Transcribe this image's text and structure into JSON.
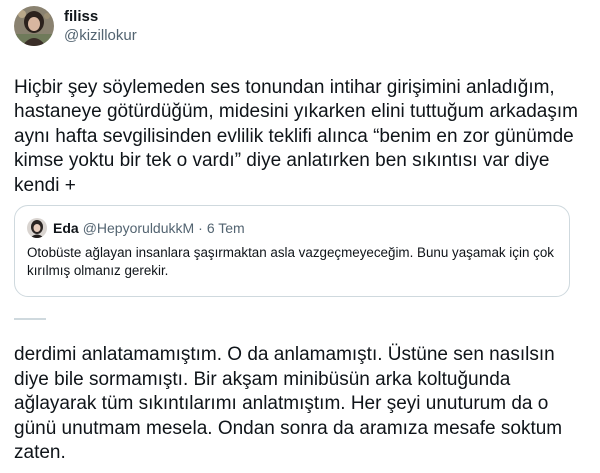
{
  "tweet": {
    "display_name": "filiss",
    "handle": "@kizillokur",
    "avatar_icon": "profile-photo",
    "text": "Hiçbir şey söylemeden ses tonundan intihar girişimini anladığım, hastaneye götürdüğüm, midesini yıkarken elini tuttuğum arkadaşım aynı hafta sevgilisinden evlilik teklifi alınca “benim en zor günümde kimse yoktu bir tek o vardı” diye anlatırken ben sıkıntısı var diye kendi +"
  },
  "quote": {
    "display_name": "Eda",
    "handle": "@HepyoruldukkM",
    "separator": "·",
    "date": "6 Tem",
    "avatar_icon": "profile-photo",
    "text": "Otobüste ağlayan insanlara şaşırmaktan asla vazgeçmeyeceğim. Bunu yaşamak için çok kırılmış olmanız gerekir."
  },
  "continuation": {
    "text": "derdimi anlatamamıştım. O da anlamamıştı. Üstüne sen nasılsın diye bile sormamıştı. Bir akşam minibüsün arka koltuğunda ağlayarak tüm sıkıntılarımı anlatmıştım. Her şeyi unuturum da o günü unutmam mesela. Ondan sonra da aramıza mesafe soktum zaten."
  },
  "colors": {
    "text": "#0f1419",
    "secondary": "#536471",
    "border": "#cfd9de"
  }
}
